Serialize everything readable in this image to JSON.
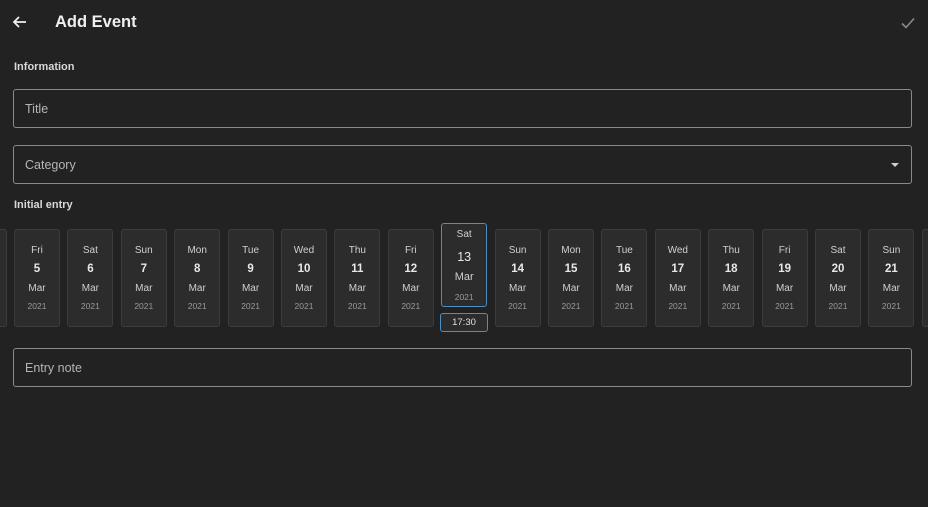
{
  "header": {
    "title": "Add Event",
    "back_icon": "arrow-left-icon",
    "save_icon": "check-icon"
  },
  "information": {
    "label": "Information",
    "title_placeholder": "Title",
    "category_placeholder": "Category"
  },
  "initial_entry": {
    "label": "Initial entry",
    "selected_time": "17:30",
    "dates": [
      {
        "dow": "Fri",
        "day": "5",
        "month": "Mar",
        "year": "2021"
      },
      {
        "dow": "Sat",
        "day": "6",
        "month": "Mar",
        "year": "2021"
      },
      {
        "dow": "Sun",
        "day": "7",
        "month": "Mar",
        "year": "2021"
      },
      {
        "dow": "Mon",
        "day": "8",
        "month": "Mar",
        "year": "2021"
      },
      {
        "dow": "Tue",
        "day": "9",
        "month": "Mar",
        "year": "2021"
      },
      {
        "dow": "Wed",
        "day": "10",
        "month": "Mar",
        "year": "2021"
      },
      {
        "dow": "Thu",
        "day": "11",
        "month": "Mar",
        "year": "2021"
      },
      {
        "dow": "Fri",
        "day": "12",
        "month": "Mar",
        "year": "2021"
      },
      {
        "dow": "Sat",
        "day": "13",
        "month": "Mar",
        "year": "2021",
        "selected": true
      },
      {
        "dow": "Sun",
        "day": "14",
        "month": "Mar",
        "year": "2021"
      },
      {
        "dow": "Mon",
        "day": "15",
        "month": "Mar",
        "year": "2021"
      },
      {
        "dow": "Tue",
        "day": "16",
        "month": "Mar",
        "year": "2021"
      },
      {
        "dow": "Wed",
        "day": "17",
        "month": "Mar",
        "year": "2021"
      },
      {
        "dow": "Thu",
        "day": "18",
        "month": "Mar",
        "year": "2021"
      },
      {
        "dow": "Fri",
        "day": "19",
        "month": "Mar",
        "year": "2021"
      },
      {
        "dow": "Sat",
        "day": "20",
        "month": "Mar",
        "year": "2021"
      },
      {
        "dow": "Sun",
        "day": "21",
        "month": "Mar",
        "year": "2021"
      }
    ],
    "note_placeholder": "Entry note"
  },
  "colors": {
    "background": "#222222",
    "accent": "#4a90c8"
  }
}
